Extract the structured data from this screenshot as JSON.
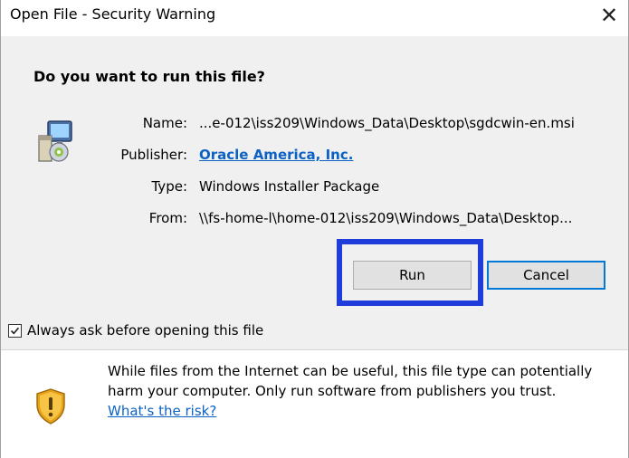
{
  "window": {
    "title": "Open File - Security Warning",
    "close_symbol": "✕"
  },
  "dialog": {
    "question": "Do you want to run this file?",
    "fields": {
      "name_label": "Name:",
      "name_value": "...e-012\\iss209\\Windows_Data\\Desktop\\sgdcwin-en.msi",
      "publisher_label": "Publisher:",
      "publisher_value": "Oracle America, Inc.",
      "type_label": "Type:",
      "type_value": "Windows Installer Package",
      "from_label": "From:",
      "from_value": "\\\\fs-home-l\\home-012\\iss209\\Windows_Data\\Desktop..."
    },
    "buttons": {
      "run": "Run",
      "cancel": "Cancel"
    },
    "checkbox": {
      "label": "Always ask before opening this file",
      "checked": true
    }
  },
  "footer": {
    "warning_line1": "While files from the Internet can be useful, this file type can potentially",
    "warning_line2": "harm your computer. Only run software from publishers you trust.",
    "risk_link": "What's the risk?"
  },
  "icons": {
    "app": "installer-package-icon",
    "shield": "warning-shield-icon"
  },
  "colors": {
    "accent": "#0078d7",
    "link": "#0b62c4",
    "highlight": "#1f3ddb",
    "body_bg": "#f0f0f0"
  }
}
